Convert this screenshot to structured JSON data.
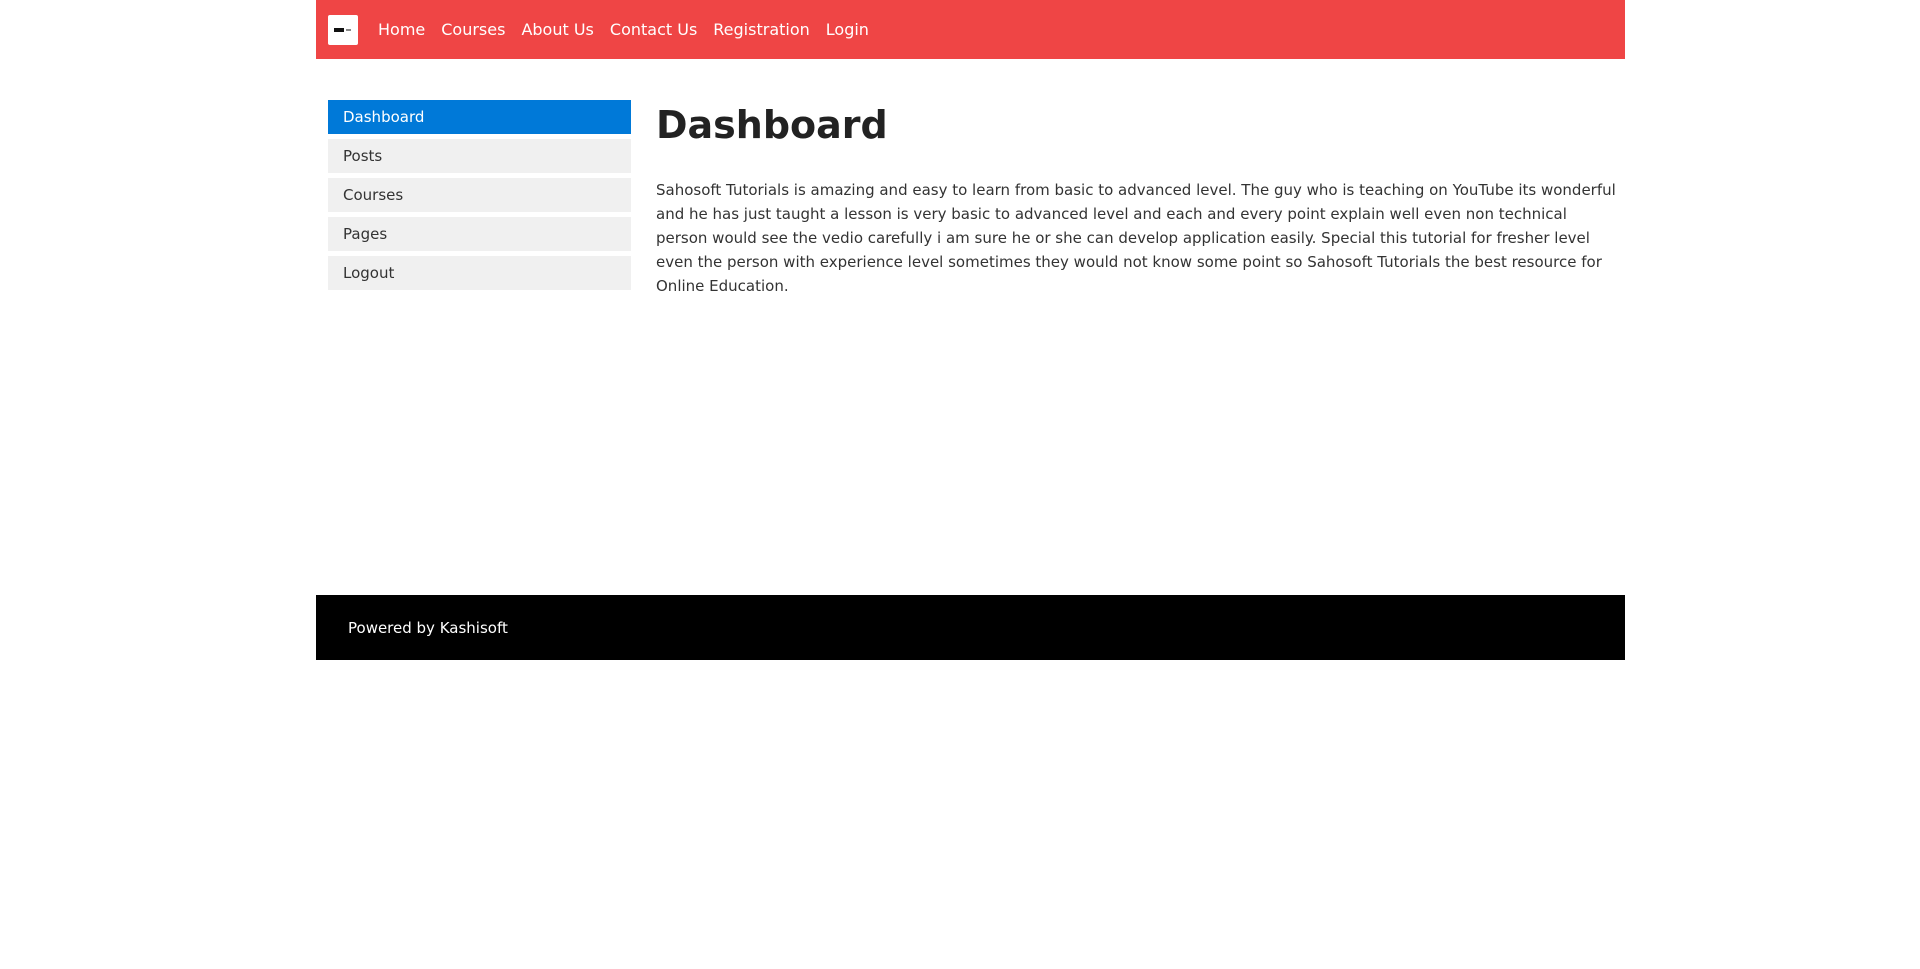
{
  "nav": {
    "logo_icon": "logo-icon",
    "links": [
      {
        "label": "Home"
      },
      {
        "label": "Courses"
      },
      {
        "label": "About Us"
      },
      {
        "label": "Contact Us"
      },
      {
        "label": "Registration"
      },
      {
        "label": "Login"
      }
    ],
    "background_color": "#ef4545"
  },
  "sidebar": {
    "items": [
      {
        "label": "Dashboard",
        "active": true
      },
      {
        "label": "Posts",
        "active": false
      },
      {
        "label": "Courses",
        "active": false
      },
      {
        "label": "Pages",
        "active": false
      },
      {
        "label": "Logout",
        "active": false
      }
    ],
    "active_color": "#0079d8"
  },
  "main": {
    "title": "Dashboard",
    "body": "Sahosoft Tutorials is amazing and easy to learn from basic to advanced level. The guy who is teaching on YouTube its wonderful and he has just taught a lesson is very basic to advanced level and each and every point explain well even non technical person would see the vedio carefully i am sure he or she can develop application easily. Special this tutorial for fresher level even the person with experience level sometimes they would not know some point so Sahosoft Tutorials the best resource for Online Education."
  },
  "footer": {
    "text": "Powered by Kashisoft"
  }
}
